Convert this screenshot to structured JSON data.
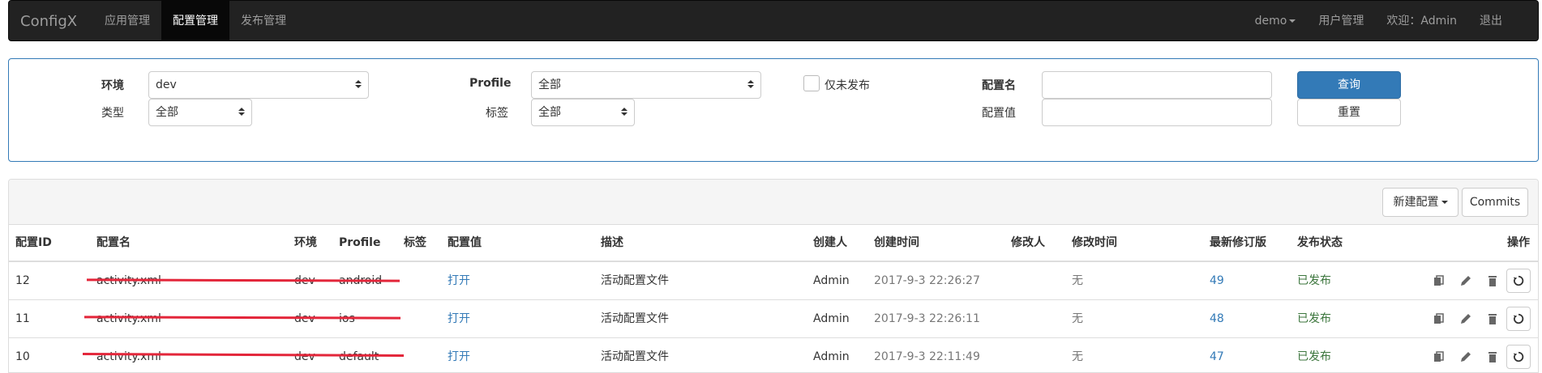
{
  "navbar": {
    "brand": "ConfigX",
    "left_items": [
      "应用管理",
      "配置管理",
      "发布管理"
    ],
    "active_index": 1,
    "user_env": "demo",
    "user_mgmt": "用户管理",
    "welcome": "欢迎：Admin",
    "logout": "退出"
  },
  "filter": {
    "env_label": "环境",
    "env_value": "dev",
    "profile_label": "Profile",
    "profile_value": "全部",
    "unpublished_label": "仅未发布",
    "name_label": "配置名",
    "name_value": "",
    "query_button": "查询",
    "type_label": "类型",
    "type_value": "全部",
    "tag_label": "标签",
    "tag_value": "全部",
    "value_label": "配置值",
    "value_value": "",
    "reset_button": "重置"
  },
  "table": {
    "new_config_button": "新建配置",
    "commits_button": "Commits",
    "columns": [
      "配置ID",
      "配置名",
      "环境",
      "Profile",
      "标签",
      "配置值",
      "描述",
      "创建人",
      "创建时间",
      "修改人",
      "修改时间",
      "最新修订版",
      "发布状态",
      "操作"
    ],
    "rows": [
      {
        "id": "12",
        "name": "activity.xml",
        "env": "dev",
        "profile": "android",
        "tag": "",
        "value": "打开",
        "desc": "活动配置文件",
        "creator": "Admin",
        "created": "2017-9-3 22:26:27",
        "modifier": "",
        "modified": "无",
        "revision": "49",
        "status": "已发布"
      },
      {
        "id": "11",
        "name": "activity.xml",
        "env": "dev",
        "profile": "ios",
        "tag": "",
        "value": "打开",
        "desc": "活动配置文件",
        "creator": "Admin",
        "created": "2017-9-3 22:26:11",
        "modifier": "",
        "modified": "无",
        "revision": "48",
        "status": "已发布"
      },
      {
        "id": "10",
        "name": "activity.xml",
        "env": "dev",
        "profile": "default",
        "tag": "",
        "value": "打开",
        "desc": "活动配置文件",
        "creator": "Admin",
        "created": "2017-9-3 22:11:49",
        "modifier": "",
        "modified": "无",
        "revision": "47",
        "status": "已发布"
      }
    ]
  },
  "colors": {
    "navbar_bg": "#222222",
    "primary": "#337ab7",
    "success_text": "#3c763d",
    "annotation_underline": "#e3263a"
  }
}
